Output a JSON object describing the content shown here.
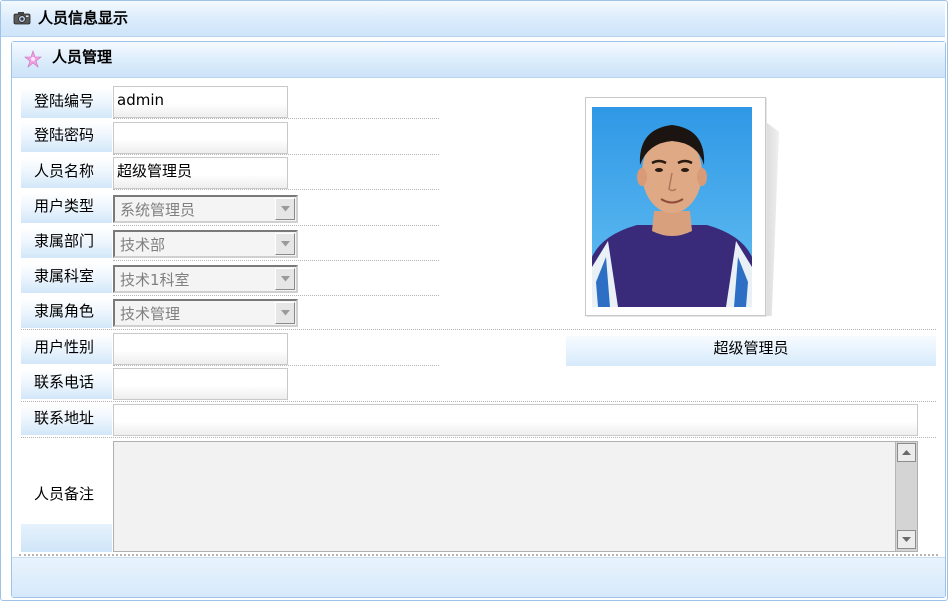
{
  "window": {
    "title": "人员信息显示"
  },
  "panel": {
    "title": "人员管理"
  },
  "form": {
    "login_id": {
      "label": "登陆编号",
      "value": "admin"
    },
    "password": {
      "label": "登陆密码",
      "value": ""
    },
    "name": {
      "label": "人员名称",
      "value": "超级管理员"
    },
    "user_type": {
      "label": "用户类型",
      "value": "系统管理员"
    },
    "department": {
      "label": "隶属部门",
      "value": "技术部"
    },
    "section": {
      "label": "隶属科室",
      "value": "技术1科室"
    },
    "role": {
      "label": "隶属角色",
      "value": "技术管理"
    },
    "gender": {
      "label": "用户性别",
      "value": ""
    },
    "phone": {
      "label": "联系电话",
      "value": ""
    },
    "address": {
      "label": "联系地址",
      "value": ""
    },
    "remark": {
      "label": "人员备注",
      "value": ""
    }
  },
  "profile": {
    "display_name": "超级管理员"
  },
  "icons": {
    "window": "camera-icon",
    "panel": "star-icon",
    "dropdown": "triangle-down-icon",
    "scroll_up": "triangle-up-icon",
    "scroll_down": "triangle-down-icon"
  },
  "colors": {
    "header_gradient": "#d8eafb",
    "border": "#9ec3e6",
    "label_gradient": "#d2e7f9",
    "photo_background": "#3a9de0",
    "shirt": "#3b2a78"
  }
}
